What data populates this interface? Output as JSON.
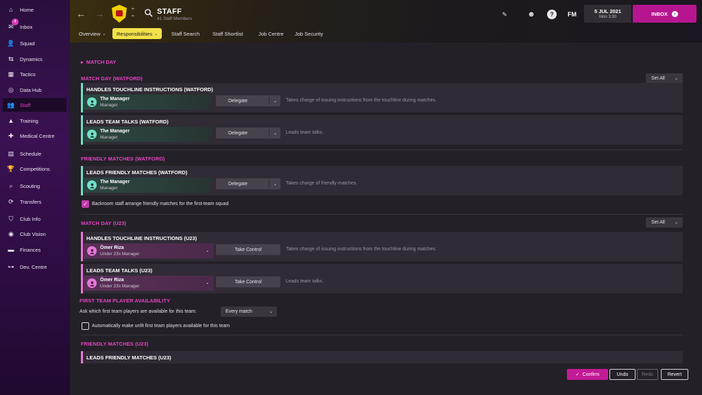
{
  "nav": {
    "items": [
      {
        "label": "Home",
        "icon": "home-icon",
        "glyph": "⌂"
      },
      {
        "label": "Inbox",
        "icon": "inbox-icon",
        "glyph": "✉",
        "badge": "4"
      },
      {
        "label": "Squad",
        "icon": "squad-icon",
        "glyph": "👤"
      },
      {
        "label": "Dynamics",
        "icon": "dynamics-icon",
        "glyph": "⇆"
      },
      {
        "label": "Tactics",
        "icon": "tactics-icon",
        "glyph": "▦"
      },
      {
        "label": "Data Hub",
        "icon": "data-hub-icon",
        "glyph": "◎"
      },
      {
        "label": "Staff",
        "icon": "staff-icon",
        "glyph": "👥"
      },
      {
        "label": "Training",
        "icon": "training-icon",
        "glyph": "▲"
      },
      {
        "label": "Medical Centre",
        "icon": "medical-icon",
        "glyph": "✚"
      },
      {
        "label": "Schedule",
        "icon": "schedule-icon",
        "glyph": "▤"
      },
      {
        "label": "Competitions",
        "icon": "trophy-icon",
        "glyph": "🏆"
      },
      {
        "label": "Scouting",
        "icon": "scouting-icon",
        "glyph": "⌕"
      },
      {
        "label": "Transfers",
        "icon": "transfers-icon",
        "glyph": "⟳"
      },
      {
        "label": "Club Info",
        "icon": "club-info-icon",
        "glyph": "⛉"
      },
      {
        "label": "Club Vision",
        "icon": "club-vision-icon",
        "glyph": "◉"
      },
      {
        "label": "Finances",
        "icon": "finances-icon",
        "glyph": "▬"
      },
      {
        "label": "Dev. Centre",
        "icon": "dev-centre-icon",
        "glyph": "⊶"
      }
    ],
    "active_index": 6
  },
  "header": {
    "title": "STAFF",
    "subtitle": "41 Staff Members",
    "fm_logo": "FM",
    "date": "5 JUL 2021",
    "date_sub": "Mon 3:30",
    "inbox_label": "INBOX",
    "tabs": [
      {
        "label": "Overview",
        "dropdown": true
      },
      {
        "label": "Responsibilities",
        "dropdown": true,
        "active": true
      },
      {
        "label": "Staff Search"
      },
      {
        "label": "Staff Shortlist"
      },
      {
        "label": "Job Centre"
      },
      {
        "label": "Job Security"
      }
    ]
  },
  "content": {
    "match_day_heading": "MATCH DAY",
    "set_all_label": "Set All",
    "sections": {
      "watford": "MATCH DAY (WATFORD)",
      "friendly_watford": "FRIENDLY MATCHES (WATFORD)",
      "u23": "MATCH DAY (U23)",
      "availability": "FIRST TEAM PLAYER AVAILABILITY",
      "friendly_u23": "FRIENDLY MATCHES (U23)"
    },
    "cards": [
      {
        "title": "HANDLES TOUCHLINE INSTRUCTIONS (WATFORD)",
        "name": "The Manager",
        "role": "Manager",
        "control": "Delegate",
        "desc": "Takes charge of issuing instructions from the touchline during matches."
      },
      {
        "title": "LEADS TEAM TALKS (WATFORD)",
        "name": "The Manager",
        "role": "Manager",
        "control": "Delegate",
        "desc": "Leads team talks."
      },
      {
        "title": "LEADS FRIENDLY MATCHES (WATFORD)",
        "name": "The Manager",
        "role": "Manager",
        "control": "Delegate",
        "desc": "Takes charge of friendly matches."
      },
      {
        "title": "HANDLES TOUCHLINE INSTRUCTIONS (U23)",
        "name": "Ömer Riza",
        "role": "Under 23s Manager",
        "control": "Take Control",
        "desc": "Takes charge of issuing instructions from the touchline during matches."
      },
      {
        "title": "LEADS TEAM TALKS (U23)",
        "name": "Ömer Riza",
        "role": "Under 23s Manager",
        "control": "Take Control",
        "desc": "Leads team talks."
      },
      {
        "title": "LEADS FRIENDLY MATCHES (U23)"
      }
    ],
    "backroom_checkbox": "Backroom staff arrange friendly matches for the first-team squad",
    "availability_prompt": "Ask which first team players are available for this team:",
    "availability_value": "Every match",
    "auto_unfit_checkbox": "Automatically make unfit first team players available for this team"
  },
  "footer": {
    "confirm": "Confirm",
    "undo": "Undo",
    "redo": "Redo",
    "revert": "Revert"
  },
  "colors": {
    "accent_pink": "#e544c2",
    "manager_teal": "#6fe0c9",
    "u23_pink": "#e877d8",
    "tab_active": "#f2e24a"
  }
}
